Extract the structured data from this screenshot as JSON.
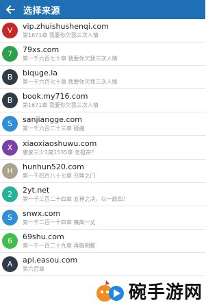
{
  "appbar": {
    "title": "选择来源",
    "color": "#1f6fb5"
  },
  "sources": [
    {
      "letter": "V",
      "color": "#c62828",
      "name": "vip.zhuishushenqi.com",
      "latest": "第1671章 我要你欠我三次人情"
    },
    {
      "letter": "7",
      "color": "#2e9f4a",
      "name": "79xs.com",
      "latest": "第一千六百七十章 我要你欠我三次人情"
    },
    {
      "letter": "B",
      "color": "#2f3b47",
      "name": "biquge.la",
      "latest": "第一千六百七十章 我要你欠我三次人情"
    },
    {
      "letter": "B",
      "color": "#2f3b47",
      "name": "book.my716.com",
      "latest": "第1671章 我要你欠我三次人情"
    },
    {
      "letter": "S",
      "color": "#2f8ed8",
      "name": "sanjiangge.com",
      "latest": "第一千六百二十三章 碰撞"
    },
    {
      "letter": "X",
      "color": "#7b3fa6",
      "name": "xiaoxiaoshuwu.com",
      "latest": "唐家三少1第1535章 老祖宗？"
    },
    {
      "letter": "H",
      "color": "#a9a38b",
      "name": "hunhun520.com",
      "latest": "第一千四百八十七章 召唤之门"
    },
    {
      "letter": "2",
      "color": "#27b39a",
      "name": "2yt.net",
      "latest": "第一千三百二十四章 五神之决，以一敌四！"
    },
    {
      "letter": "S",
      "color": "#2f8ed8",
      "name": "snwx.com",
      "latest": "第一千二百一十四章 魔高一丈"
    },
    {
      "letter": "6",
      "color": "#3fbf4a",
      "name": "69shu.com",
      "latest": "第一千一百二十九章 再临明都"
    },
    {
      "letter": "A",
      "color": "#2f3b47",
      "name": "api.easou.com",
      "latest": "第六百章"
    }
  ],
  "watermark": {
    "text": "碗手游网",
    "logo_colors": [
      "#f28c1c",
      "#1e88e5"
    ]
  }
}
